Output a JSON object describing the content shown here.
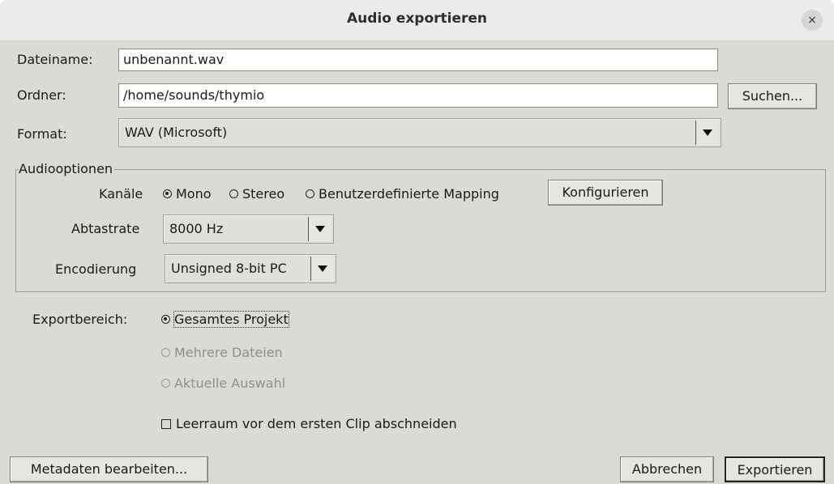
{
  "dialog": {
    "title": "Audio exportieren",
    "close_glyph": "×"
  },
  "file": {
    "name_label": "Dateiname:",
    "name_value": "unbenannt.wav",
    "folder_label": "Ordner:",
    "folder_value": "/home/sounds/thymio",
    "browse_label": "Suchen...",
    "format_label": "Format:",
    "format_value": "WAV (Microsoft)"
  },
  "audio_options": {
    "group_title": "Audiooptionen",
    "channels_label": "Kanäle",
    "channels": [
      {
        "label": "Mono",
        "selected": true
      },
      {
        "label": "Stereo",
        "selected": false
      },
      {
        "label": "Benutzerdefinierte Mapping",
        "selected": false
      }
    ],
    "configure_label": "Konfigurieren",
    "sample_rate_label": "Abtastrate",
    "sample_rate_value": "8000 Hz",
    "encoding_label": "Encodierung",
    "encoding_value": "Unsigned 8-bit PC"
  },
  "export_range": {
    "label": "Exportbereich:",
    "options": [
      {
        "label": "Gesamtes Projekt",
        "selected": true,
        "enabled": true
      },
      {
        "label": "Mehrere Dateien",
        "selected": false,
        "enabled": false
      },
      {
        "label": "Aktuelle Auswahl",
        "selected": false,
        "enabled": false
      }
    ],
    "trim_label": "Leerraum vor dem ersten Clip abschneiden",
    "trim_checked": false
  },
  "footer": {
    "metadata_label": "Metadaten bearbeiten...",
    "cancel_label": "Abbrechen",
    "export_label": "Exportieren"
  }
}
